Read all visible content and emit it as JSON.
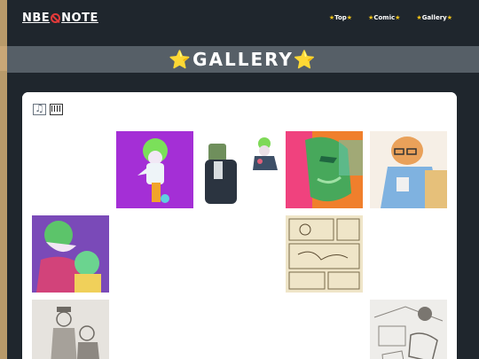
{
  "header": {
    "logo_left": "NBE",
    "logo_right": "NOTE",
    "nav": [
      {
        "label": "Top"
      },
      {
        "label": "Comic"
      },
      {
        "label": "Gallery"
      }
    ]
  },
  "title_band": {
    "title": "GALLERY"
  },
  "colors": {
    "background": "#1f262d",
    "title_band": "#565f67",
    "star": "#f5c518",
    "logo_mark": "#e23a3a"
  },
  "toolbar": {
    "icons": [
      "music-note-icon",
      "piano-keys-icon"
    ]
  },
  "gallery": {
    "thumbnails": [
      {
        "name": "green-hair-character-purple"
      },
      {
        "name": "monster-suit-and-small-figure"
      },
      {
        "name": "green-faced-portrait"
      },
      {
        "name": "man-with-glasses-drinking"
      },
      {
        "name": "green-hair-pair-purple-tones"
      },
      {
        "name": "manga-page-sketch"
      },
      {
        "name": "pencil-sketch-two-figures"
      },
      {
        "name": "pencil-sketch-interior"
      }
    ]
  }
}
